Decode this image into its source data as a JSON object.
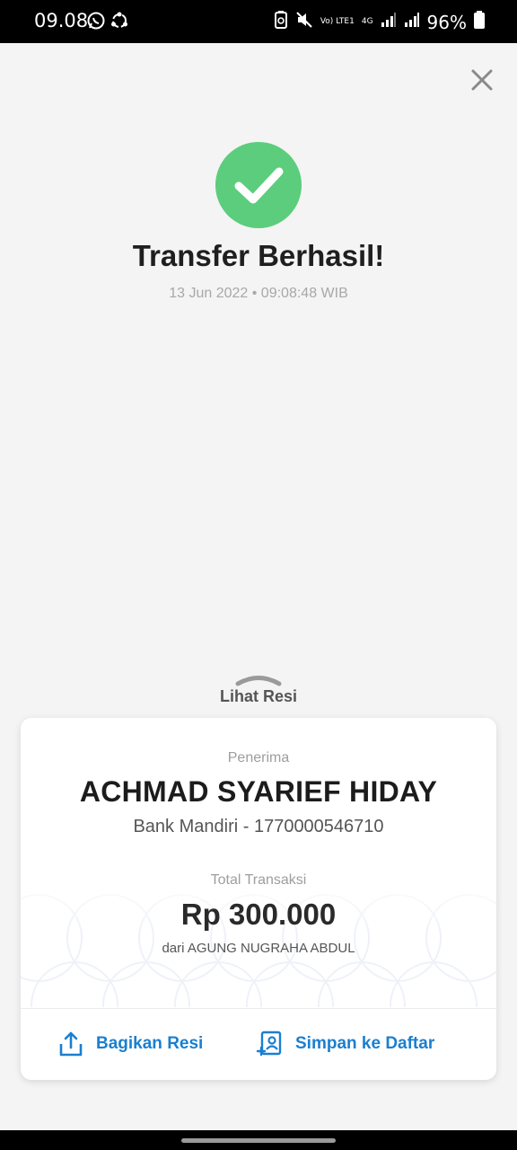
{
  "status_bar": {
    "time": "09.08",
    "network_label": "Vo) LTE1",
    "network_type": "4G",
    "battery": "96%",
    "left_icons": [
      "whatsapp-icon",
      "sync-icon"
    ],
    "right_icons": [
      "battery-saver-icon",
      "mute-icon",
      "volte-icon",
      "network-4g-icon",
      "signal-icon",
      "signal-icon",
      "battery-icon"
    ]
  },
  "header": {
    "close_icon": "close-icon"
  },
  "result": {
    "status_icon": "check-circle-icon",
    "status_color": "#5ccd7c",
    "title": "Transfer Berhasil!",
    "timestamp": "13 Jun 2022 • 09:08:48 WIB"
  },
  "sheet": {
    "handle_icon": "chevron-up-icon",
    "toggle_label": "Lihat Resi"
  },
  "receipt": {
    "recipient_label": "Penerima",
    "recipient_name": "ACHMAD SYARIEF HIDAY",
    "bank_info": "Bank Mandiri - 1770000546710",
    "total_label": "Total Transaksi",
    "amount": "Rp 300.000",
    "sender": "dari AGUNG NUGRAHA ABDUL"
  },
  "actions": [
    {
      "label": "Bagikan Resi",
      "icon": "share-icon"
    },
    {
      "label": "Simpan ke Daftar",
      "icon": "save-contact-icon"
    }
  ],
  "colors": {
    "accent": "#1a7fd0",
    "success": "#5ccd7c",
    "background": "#f4f4f4"
  }
}
